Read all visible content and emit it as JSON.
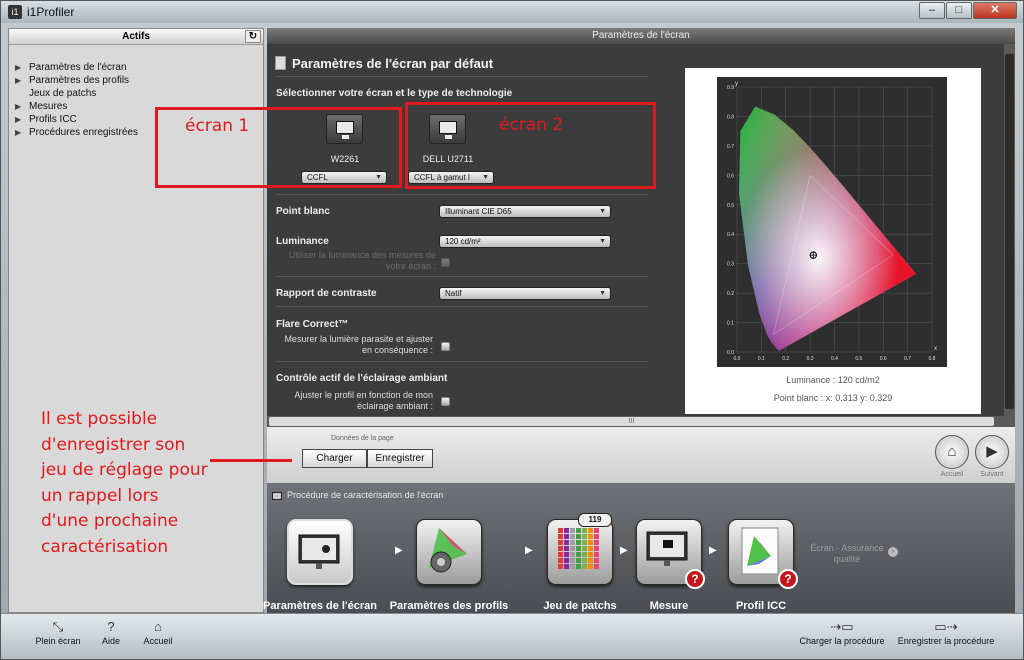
{
  "window": {
    "app_icon": "i1",
    "title": "i1Profiler",
    "minimize": "–",
    "maximize": "□",
    "close": "✕"
  },
  "left_panel": {
    "header": "Actifs",
    "refresh_icon": "↻",
    "items": [
      {
        "label": "Paramètres de l'écran",
        "expandable": true
      },
      {
        "label": "Paramètres des profils",
        "expandable": true
      },
      {
        "label": "Jeux de patchs",
        "expandable": false
      },
      {
        "label": "Mesures",
        "expandable": true
      },
      {
        "label": "Profils ICC",
        "expandable": true
      },
      {
        "label": "Procédures enregistrées",
        "expandable": true
      }
    ]
  },
  "center": {
    "header": "Paramètres de l'écran",
    "page_title": "Paramètres de l'écran par défaut",
    "select_label": "Sélectionner votre écran et le type de technologie",
    "screens": [
      {
        "name": "W2261",
        "tech": "CCFL"
      },
      {
        "name": "DELL U2711",
        "tech": "CCFL à gamut l"
      }
    ],
    "white_point": {
      "label": "Point blanc",
      "value": "Illuminant CIE D65"
    },
    "luminance": {
      "label": "Luminance",
      "value": "120 cd/m²",
      "ambient_option": "Utiliser la luminance des mesures de votre écran :"
    },
    "contrast": {
      "label": "Rapport de contraste",
      "value": "Natif"
    },
    "flare": {
      "label": "Flare Correct™",
      "option": "Mesurer la lumière parasite et ajuster en conséquence :"
    },
    "ambient": {
      "label": "Contrôle actif de l'éclairage ambiant",
      "option": "Ajuster le profil en fonction de mon éclairage ambiant :"
    },
    "chart": {
      "luminance_caption": "Luminance :  120 cd/m2",
      "white_point_caption": "Point blanc : x: 0.313  y: 0.329",
      "x_axis_label": "x",
      "y_axis_label": "y"
    },
    "scroll_grip": "III"
  },
  "chart_data": {
    "type": "scatter",
    "title": "",
    "xlabel": "x",
    "ylabel": "y",
    "xlim": [
      0,
      0.8
    ],
    "ylim": [
      0,
      0.9
    ],
    "x_ticks": [
      "0.0",
      "0.1",
      "0.2",
      "0.3",
      "0.4",
      "0.5",
      "0.6",
      "0.7",
      "0.8"
    ],
    "y_ticks": [
      "0.0",
      "0.1",
      "0.2",
      "0.3",
      "0.4",
      "0.5",
      "0.6",
      "0.7",
      "0.8",
      "0.9"
    ],
    "gamut_triangle": [
      [
        0.64,
        0.33
      ],
      [
        0.3,
        0.6
      ],
      [
        0.15,
        0.06
      ]
    ],
    "white_point": [
      0.313,
      0.329
    ],
    "grid": true
  },
  "page_data_bar": {
    "label": "Données de la page",
    "load_button": "Charger",
    "save_button": "Enregistrer",
    "home_label": "Accueil",
    "next_label": "Suivant"
  },
  "workflow": {
    "header": "Procédure de caractérisation de l'écran",
    "steps": [
      {
        "label": "Paramètres de l'écran"
      },
      {
        "label": "Paramètres des profils"
      },
      {
        "label": "Jeu de patchs",
        "badge": "119"
      },
      {
        "label": "Mesure",
        "alert": "?"
      },
      {
        "label": "Profil ICC",
        "alert": "?"
      }
    ],
    "qa_label": "Écran - Assurance qualité"
  },
  "bottom_bar": {
    "full_screen": "Plein écran",
    "help": "Aide",
    "home": "Accueil",
    "load_procedure": "Charger la procédure",
    "save_procedure": "Enregistrer la procédure"
  },
  "annotations": {
    "screen1": "écran 1",
    "screen2": "écran 2",
    "note": "Il est possible d'enregistrer son jeu de réglage pour un rappel lors d'une prochaine caractérisation",
    "color": "#e0191d"
  }
}
